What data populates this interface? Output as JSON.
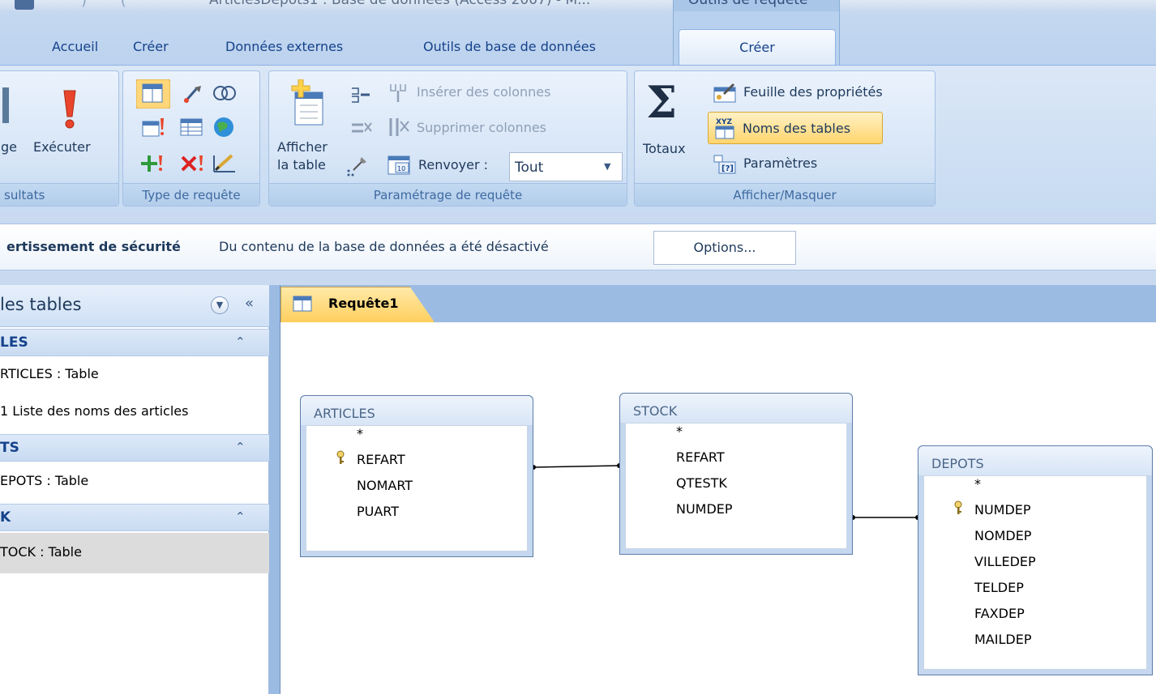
{
  "titlebar": {
    "title": "ArticlesDepots1 : Base de données (Access 2007) - M...",
    "contextual": "Outils de requête"
  },
  "tabs": {
    "accueil": "Accueil",
    "creer": "Créer",
    "donnees_externes": "Données externes",
    "outils_bdd": "Outils de base de données",
    "creer_active": "Créer"
  },
  "ribbon": {
    "resultats": {
      "label": "sultats",
      "affichage": "ge",
      "executer": "Exécuter"
    },
    "type_requete": {
      "label": "Type de requête"
    },
    "parametrage": {
      "label": "Paramétrage de requête",
      "afficher_table_1": "Afficher",
      "afficher_table_2": "la table",
      "inserer_colonnes": "Insérer des colonnes",
      "supprimer_colonnes": "Supprimer colonnes",
      "renvoyer_label": "Renvoyer :",
      "renvoyer_value": "Tout"
    },
    "afficher_masquer": {
      "label": "Afficher/Masquer",
      "totaux": "Totaux",
      "feuille_proprietes": "Feuille des propriétés",
      "noms_tables": "Noms des tables",
      "parametres": "Paramètres"
    }
  },
  "security": {
    "title": "ertissement de sécurité",
    "message": "Du contenu de la base de données a été désactivé",
    "options": "Options..."
  },
  "nav": {
    "title": "les tables",
    "groups": [
      {
        "label": "LES",
        "items": [
          "RTICLES : Table",
          "1 Liste des noms des articles"
        ]
      },
      {
        "label": "TS",
        "items": [
          "EPOTS : Table"
        ]
      },
      {
        "label": "K",
        "items": [
          "TOCK : Table"
        ]
      }
    ]
  },
  "document": {
    "tab_label": "Requête1"
  },
  "tables": {
    "articles": {
      "name": "ARTICLES",
      "fields": [
        "*",
        "REFART",
        "NOMART",
        "PUART"
      ]
    },
    "stock": {
      "name": "STOCK",
      "fields": [
        "*",
        "REFART",
        "QTESTK",
        "NUMDEP"
      ]
    },
    "depots": {
      "name": "DEPOTS",
      "fields": [
        "*",
        "NUMDEP",
        "NOMDEP",
        "VILLEDEP",
        "TELDEP",
        "FAXDEP",
        "MAILDEP"
      ]
    }
  }
}
